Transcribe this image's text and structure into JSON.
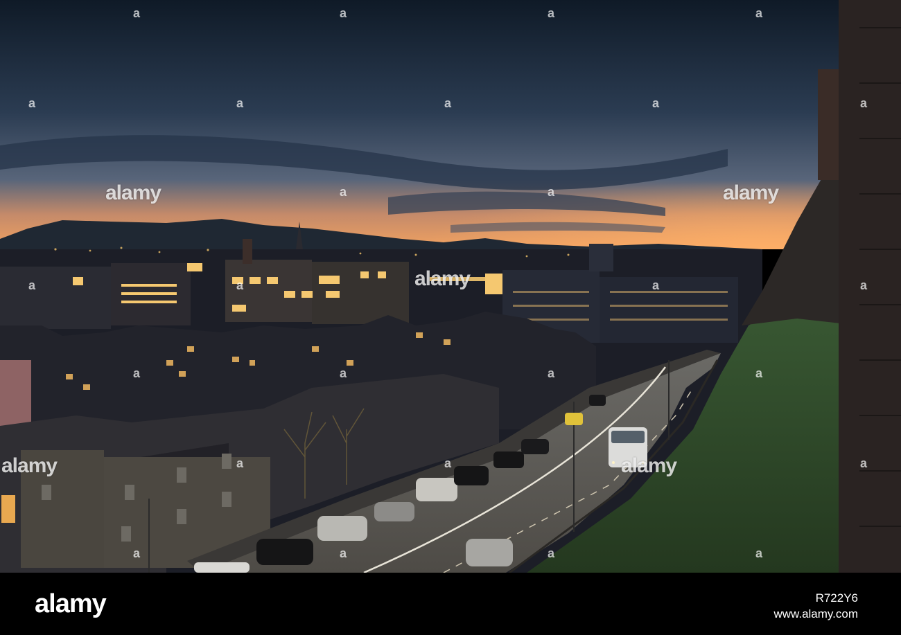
{
  "watermark": {
    "brand": "alamy",
    "glyph": "a"
  },
  "footer": {
    "logo": "alamy",
    "image_id": "R722Y6",
    "url": "www.alamy.com"
  },
  "colors": {
    "sky_top": "#14202e",
    "sky_mid": "#3d5066",
    "horizon_glow": "#f0a060",
    "city_dark": "#1d1f28",
    "window_light": "#f3c46a",
    "grass": "#2f4a2c"
  }
}
